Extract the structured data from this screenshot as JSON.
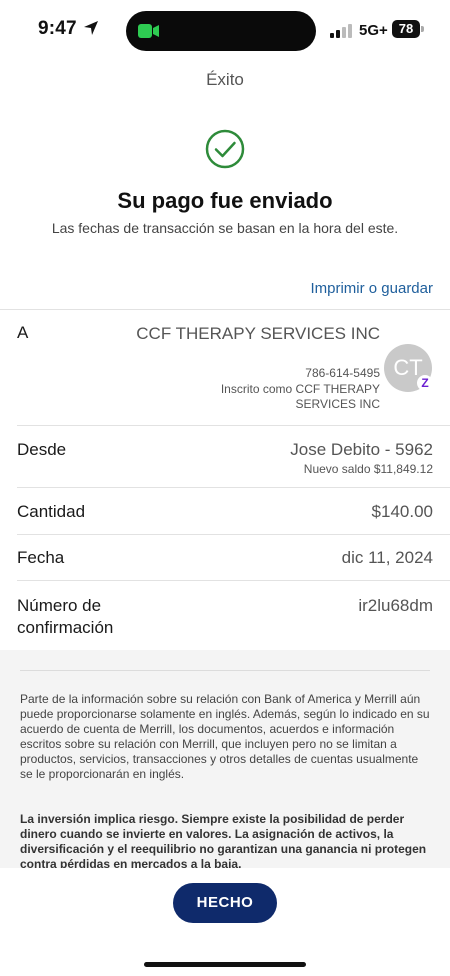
{
  "status_bar": {
    "time": "9:47",
    "network": "5G+",
    "battery": "78",
    "icons": [
      "location-arrow-icon",
      "facetime-camera-icon",
      "signal-bars-icon"
    ]
  },
  "screen": {
    "title": "Éxito",
    "headline": "Su pago fue enviado",
    "subline": "Las fechas de transacción se basan en la hora del este.",
    "print_link": "Imprimir o guardar",
    "success_color": "#2e8b3a"
  },
  "details": {
    "to": {
      "label": "A",
      "name": "CCF THERAPY SERVICES INC",
      "phone": "786-614-5495",
      "registered_as": "Inscrito como CCF THERAPY SERVICES INC",
      "avatar_initials": "CT",
      "badge": "Z"
    },
    "from": {
      "label": "Desde",
      "account": "Jose Debito - 5962",
      "balance": "Nuevo saldo $11,849.12"
    },
    "amount": {
      "label": "Cantidad",
      "value": "$140.00"
    },
    "date": {
      "label": "Fecha",
      "value": "dic 11, 2024"
    },
    "confirmation": {
      "label": "Número de confirmación",
      "value": "ir2lu68dm"
    }
  },
  "disclaimer": {
    "p1": "Parte de la información sobre su relación con Bank of America y Merrill aún puede proporcionarse solamente en inglés. Además, según lo indicado en su acuerdo de cuenta de Merrill, los documentos, acuerdos e información escritos sobre su relación con Merrill, que incluyen pero no se limitan a productos, servicios, transacciones y otros detalles de cuentas usualmente se le proporcionarán en inglés.",
    "p2": "La inversión implica riesgo. Siempre existe la posibilidad de perder dinero cuando se invierte en valores. La asignación de activos, la diversificación y el reequilibrio no garantizan una ganancia ni protegen contra pérdidas en mercados a la baja."
  },
  "actions": {
    "done_label": "HECHO",
    "done_color": "#0f2a6b",
    "link_color": "#1f5f9c"
  }
}
